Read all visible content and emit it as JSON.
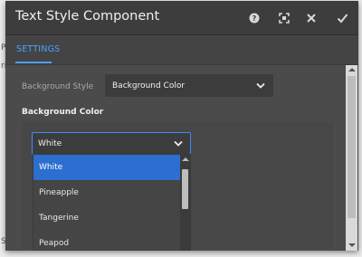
{
  "dialog": {
    "title": "Text Style Component",
    "icons": [
      "help-icon",
      "fullscreen-icon",
      "close-icon",
      "done-checkmark-icon"
    ]
  },
  "tabs": [
    {
      "label": "SETTINGS",
      "active": true
    }
  ],
  "background_style": {
    "label": "Background Style",
    "value": "Background Color"
  },
  "background_color": {
    "heading": "Background Color",
    "selected": "White",
    "options": [
      "White",
      "Pineapple",
      "Tangerine",
      "Peapod"
    ]
  },
  "colors": {
    "accent": "#4aa0ff",
    "selection": "#2d6ed1",
    "dialog_bg": "#4b4b4b",
    "titlebar_bg": "#3d3d3d"
  }
}
